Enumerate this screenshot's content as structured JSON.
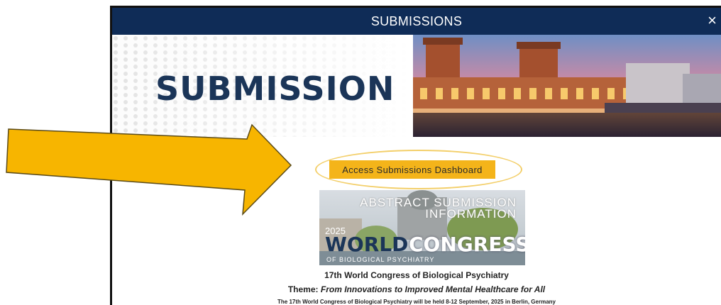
{
  "modal": {
    "title": "SUBMISSIONS",
    "close_label": "×"
  },
  "banner": {
    "heading": "SUBMISSION"
  },
  "cta": {
    "label": "Access Submissions Dashboard"
  },
  "info_image": {
    "title_line1": "ABSTRACT SUBMISSION",
    "title_line2": "INFORMATION",
    "year": "2025",
    "world": "WORLD",
    "congress": "CONGRESS",
    "subtitle": "OF BIOLOGICAL PSYCHIATRY"
  },
  "content": {
    "line1": "17th World Congress of Biological Psychiatry",
    "theme_prefix": "Theme:",
    "theme": "From Innovations to Improved Mental Healthcare for All",
    "line3": "The 17th World Congress of Biological Psychiatry will be held 8-12 September, 2025 in Berlin, Germany"
  },
  "colors": {
    "header_navy": "#0f2c57",
    "accent_yellow": "#f4b41a",
    "arrow_yellow": "#f7b500",
    "heading_navy": "#1b3558"
  }
}
